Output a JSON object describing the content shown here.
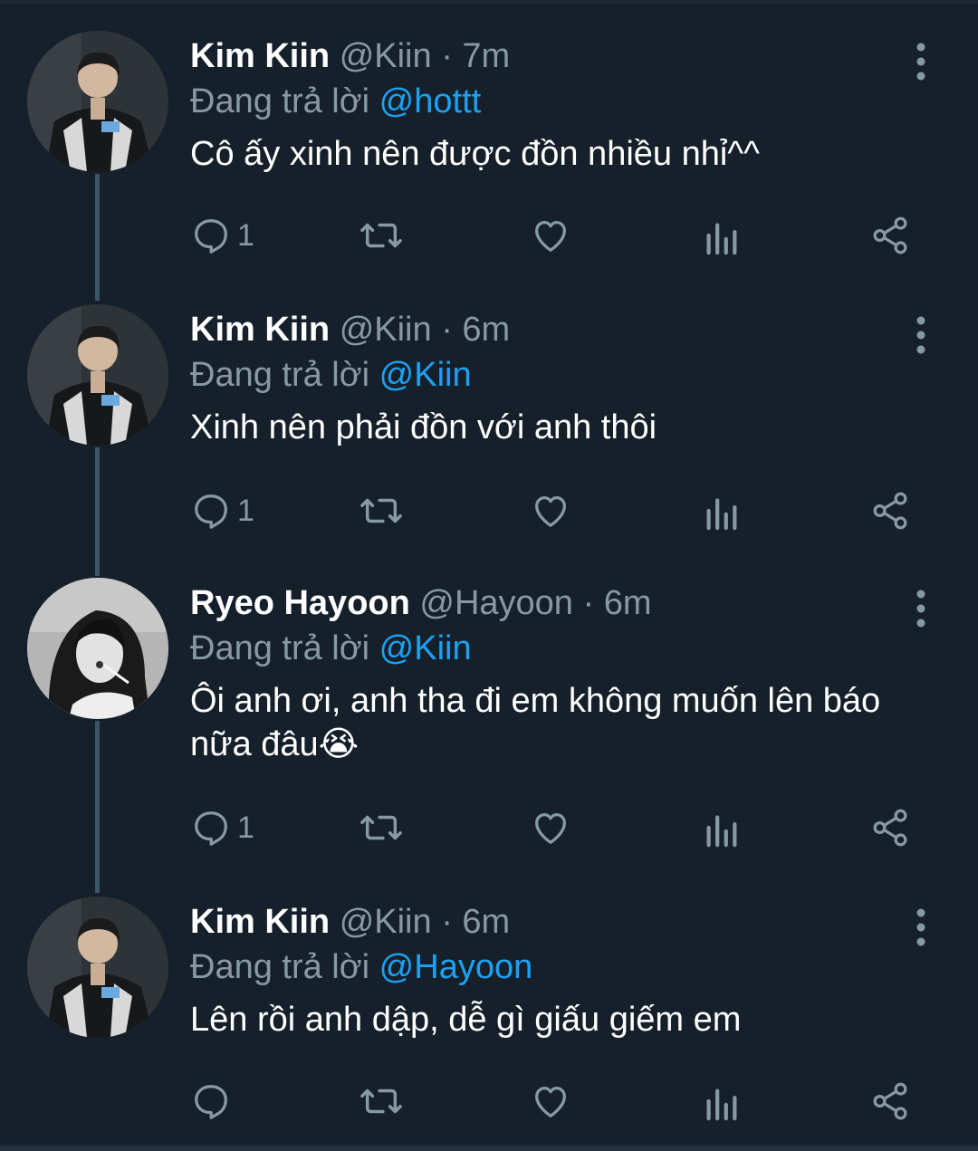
{
  "tweets": [
    {
      "name": "Kim Kiin",
      "handle": "@Kiin",
      "time": "· 7m",
      "reply_prefix": "Đang trả lời",
      "reply_to": "@hottt",
      "text": "Cô ấy xinh nên được đồn nhiều nhỉ^^",
      "reply_count": "1"
    },
    {
      "name": "Kim Kiin",
      "handle": "@Kiin",
      "time": "· 6m",
      "reply_prefix": "Đang trả lời",
      "reply_to": "@Kiin",
      "text": "Xinh nên phải đồn với anh thôi",
      "reply_count": "1"
    },
    {
      "name": "Ryeo Hayoon",
      "handle": "@Hayoon",
      "time": "· 6m",
      "reply_prefix": "Đang trả lời",
      "reply_to": "@Kiin",
      "text": "Ôi anh ơi, anh tha đi em không muốn lên báo nữa đâu😭",
      "reply_count": "1"
    },
    {
      "name": "Kim Kiin",
      "handle": "@Kiin",
      "time": "· 6m",
      "reply_prefix": "Đang trả lời",
      "reply_to": "@Hayoon",
      "text": "Lên rồi anh dập, dễ gì giấu giếm em",
      "reply_count": ""
    }
  ],
  "icons": {
    "reply": "reply-icon",
    "retweet": "retweet-icon",
    "like": "heart-icon",
    "analytics": "analytics-icon",
    "share": "share-icon",
    "more": "more-vertical-icon"
  },
  "colors": {
    "background": "#15202b",
    "text": "#ffffff",
    "muted": "#8899a6",
    "link": "#1da1f2",
    "thread_line": "#3d5466"
  }
}
